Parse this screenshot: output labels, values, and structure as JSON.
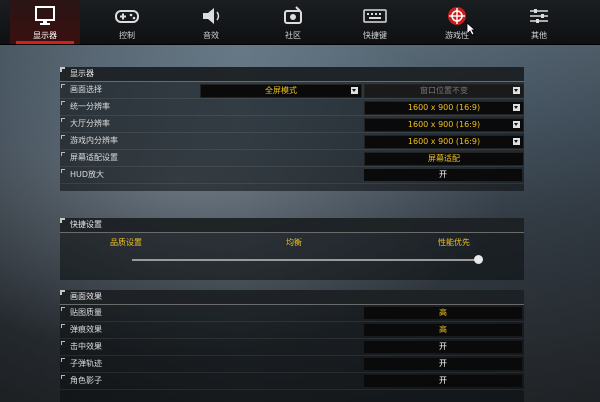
{
  "nav": {
    "tabs": [
      {
        "label": "显示器",
        "icon": "monitor-icon",
        "active": true
      },
      {
        "label": "控制",
        "icon": "gamepad-icon",
        "active": false
      },
      {
        "label": "音效",
        "icon": "speaker-icon",
        "active": false
      },
      {
        "label": "社区",
        "icon": "community-icon",
        "active": false
      },
      {
        "label": "快捷键",
        "icon": "keyboard-icon",
        "active": false
      },
      {
        "label": "游戏性",
        "icon": "crosshair-icon",
        "active": false
      },
      {
        "label": "其他",
        "icon": "sliders-icon",
        "active": false
      }
    ]
  },
  "display": {
    "title": "显示器",
    "mode_label": "画面选择",
    "mode_value": "全屏模式",
    "window_pos_value": "窗口位置不变",
    "rows": [
      {
        "label": "统一分辨率",
        "value": "1600 x 900 (16:9)"
      },
      {
        "label": "大厅分辨率",
        "value": "1600 x 900 (16:9)"
      },
      {
        "label": "游戏内分辨率",
        "value": "1600 x 900 (16:9)"
      }
    ],
    "adapt_label": "屏幕适配设置",
    "adapt_value": "屏幕适配",
    "hud_label": "HUD放大",
    "hud_value": "开"
  },
  "quick": {
    "title": "快捷设置",
    "left": "品质设置",
    "mid": "均衡",
    "right": "性能优先",
    "level": 1.0
  },
  "effects": {
    "title": "画面效果",
    "rows": [
      {
        "label": "贴图质量",
        "value": "高"
      },
      {
        "label": "弹痕效果",
        "value": "高"
      },
      {
        "label": "击中效果",
        "value": "开"
      },
      {
        "label": "子弹轨迹",
        "value": "开"
      },
      {
        "label": "角色影子",
        "value": "开"
      }
    ]
  },
  "colors": {
    "accent": "#d02020",
    "value_text": "#f0c020"
  }
}
